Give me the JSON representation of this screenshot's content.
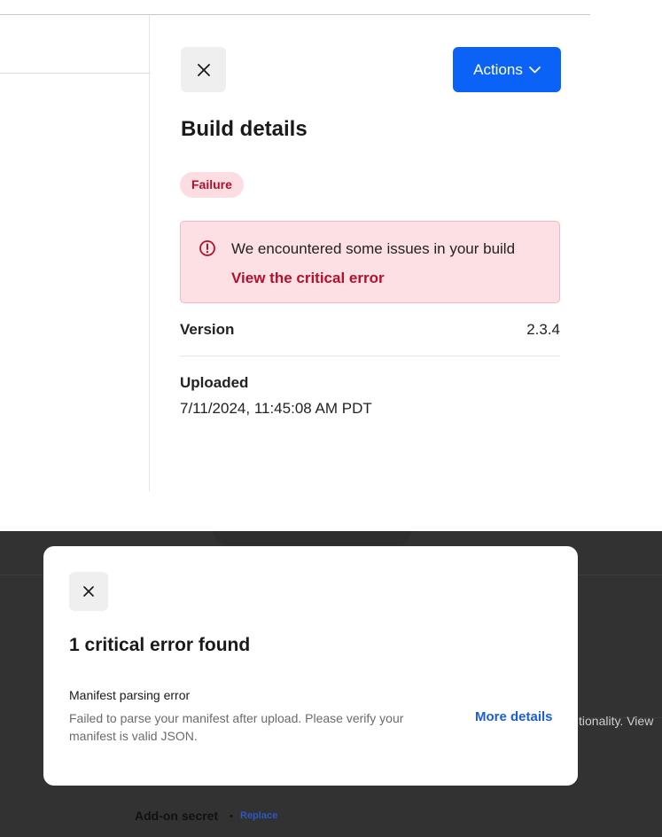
{
  "panel": {
    "title": "Build details",
    "actions_label": "Actions",
    "status": "Failure",
    "alert": {
      "message": "We encountered some issues in your build",
      "link": "View the critical error"
    },
    "fields": {
      "version_label": "Version",
      "version_value": "2.3.4",
      "uploaded_label": "Uploaded",
      "uploaded_value": "7/11/2024, 11:45:08 AM PDT"
    }
  },
  "modal": {
    "title": "1 critical error found",
    "error": {
      "title": "Manifest parsing error",
      "description": "Failed to parse your manifest after upload. Please verify your manifest is valid JSON.",
      "link": "More details"
    }
  },
  "background": {
    "snippet": "tionality. View",
    "secret_label": "Add-on secret",
    "separator": "•",
    "replace_label": "Replace"
  },
  "colors": {
    "primary": "#0a63f6",
    "danger": "#b3102c",
    "danger_bg": "#fde0e4",
    "link": "#1a5edb",
    "overlay": "#323232"
  },
  "icons": {
    "close": "close-icon",
    "chevron": "chevron-down-icon",
    "alert": "alert-circle-icon"
  }
}
